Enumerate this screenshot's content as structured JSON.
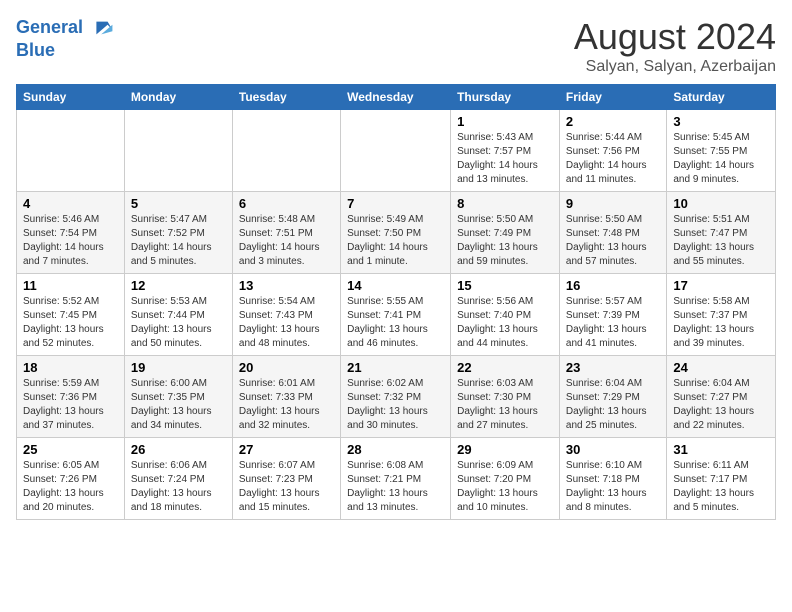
{
  "header": {
    "logo_line1": "General",
    "logo_line2": "Blue",
    "month": "August 2024",
    "location": "Salyan, Salyan, Azerbaijan"
  },
  "weekdays": [
    "Sunday",
    "Monday",
    "Tuesday",
    "Wednesday",
    "Thursday",
    "Friday",
    "Saturday"
  ],
  "weeks": [
    [
      {
        "day": "",
        "info": ""
      },
      {
        "day": "",
        "info": ""
      },
      {
        "day": "",
        "info": ""
      },
      {
        "day": "",
        "info": ""
      },
      {
        "day": "1",
        "info": "Sunrise: 5:43 AM\nSunset: 7:57 PM\nDaylight: 14 hours\nand 13 minutes."
      },
      {
        "day": "2",
        "info": "Sunrise: 5:44 AM\nSunset: 7:56 PM\nDaylight: 14 hours\nand 11 minutes."
      },
      {
        "day": "3",
        "info": "Sunrise: 5:45 AM\nSunset: 7:55 PM\nDaylight: 14 hours\nand 9 minutes."
      }
    ],
    [
      {
        "day": "4",
        "info": "Sunrise: 5:46 AM\nSunset: 7:54 PM\nDaylight: 14 hours\nand 7 minutes."
      },
      {
        "day": "5",
        "info": "Sunrise: 5:47 AM\nSunset: 7:52 PM\nDaylight: 14 hours\nand 5 minutes."
      },
      {
        "day": "6",
        "info": "Sunrise: 5:48 AM\nSunset: 7:51 PM\nDaylight: 14 hours\nand 3 minutes."
      },
      {
        "day": "7",
        "info": "Sunrise: 5:49 AM\nSunset: 7:50 PM\nDaylight: 14 hours\nand 1 minute."
      },
      {
        "day": "8",
        "info": "Sunrise: 5:50 AM\nSunset: 7:49 PM\nDaylight: 13 hours\nand 59 minutes."
      },
      {
        "day": "9",
        "info": "Sunrise: 5:50 AM\nSunset: 7:48 PM\nDaylight: 13 hours\nand 57 minutes."
      },
      {
        "day": "10",
        "info": "Sunrise: 5:51 AM\nSunset: 7:47 PM\nDaylight: 13 hours\nand 55 minutes."
      }
    ],
    [
      {
        "day": "11",
        "info": "Sunrise: 5:52 AM\nSunset: 7:45 PM\nDaylight: 13 hours\nand 52 minutes."
      },
      {
        "day": "12",
        "info": "Sunrise: 5:53 AM\nSunset: 7:44 PM\nDaylight: 13 hours\nand 50 minutes."
      },
      {
        "day": "13",
        "info": "Sunrise: 5:54 AM\nSunset: 7:43 PM\nDaylight: 13 hours\nand 48 minutes."
      },
      {
        "day": "14",
        "info": "Sunrise: 5:55 AM\nSunset: 7:41 PM\nDaylight: 13 hours\nand 46 minutes."
      },
      {
        "day": "15",
        "info": "Sunrise: 5:56 AM\nSunset: 7:40 PM\nDaylight: 13 hours\nand 44 minutes."
      },
      {
        "day": "16",
        "info": "Sunrise: 5:57 AM\nSunset: 7:39 PM\nDaylight: 13 hours\nand 41 minutes."
      },
      {
        "day": "17",
        "info": "Sunrise: 5:58 AM\nSunset: 7:37 PM\nDaylight: 13 hours\nand 39 minutes."
      }
    ],
    [
      {
        "day": "18",
        "info": "Sunrise: 5:59 AM\nSunset: 7:36 PM\nDaylight: 13 hours\nand 37 minutes."
      },
      {
        "day": "19",
        "info": "Sunrise: 6:00 AM\nSunset: 7:35 PM\nDaylight: 13 hours\nand 34 minutes."
      },
      {
        "day": "20",
        "info": "Sunrise: 6:01 AM\nSunset: 7:33 PM\nDaylight: 13 hours\nand 32 minutes."
      },
      {
        "day": "21",
        "info": "Sunrise: 6:02 AM\nSunset: 7:32 PM\nDaylight: 13 hours\nand 30 minutes."
      },
      {
        "day": "22",
        "info": "Sunrise: 6:03 AM\nSunset: 7:30 PM\nDaylight: 13 hours\nand 27 minutes."
      },
      {
        "day": "23",
        "info": "Sunrise: 6:04 AM\nSunset: 7:29 PM\nDaylight: 13 hours\nand 25 minutes."
      },
      {
        "day": "24",
        "info": "Sunrise: 6:04 AM\nSunset: 7:27 PM\nDaylight: 13 hours\nand 22 minutes."
      }
    ],
    [
      {
        "day": "25",
        "info": "Sunrise: 6:05 AM\nSunset: 7:26 PM\nDaylight: 13 hours\nand 20 minutes."
      },
      {
        "day": "26",
        "info": "Sunrise: 6:06 AM\nSunset: 7:24 PM\nDaylight: 13 hours\nand 18 minutes."
      },
      {
        "day": "27",
        "info": "Sunrise: 6:07 AM\nSunset: 7:23 PM\nDaylight: 13 hours\nand 15 minutes."
      },
      {
        "day": "28",
        "info": "Sunrise: 6:08 AM\nSunset: 7:21 PM\nDaylight: 13 hours\nand 13 minutes."
      },
      {
        "day": "29",
        "info": "Sunrise: 6:09 AM\nSunset: 7:20 PM\nDaylight: 13 hours\nand 10 minutes."
      },
      {
        "day": "30",
        "info": "Sunrise: 6:10 AM\nSunset: 7:18 PM\nDaylight: 13 hours\nand 8 minutes."
      },
      {
        "day": "31",
        "info": "Sunrise: 6:11 AM\nSunset: 7:17 PM\nDaylight: 13 hours\nand 5 minutes."
      }
    ]
  ]
}
